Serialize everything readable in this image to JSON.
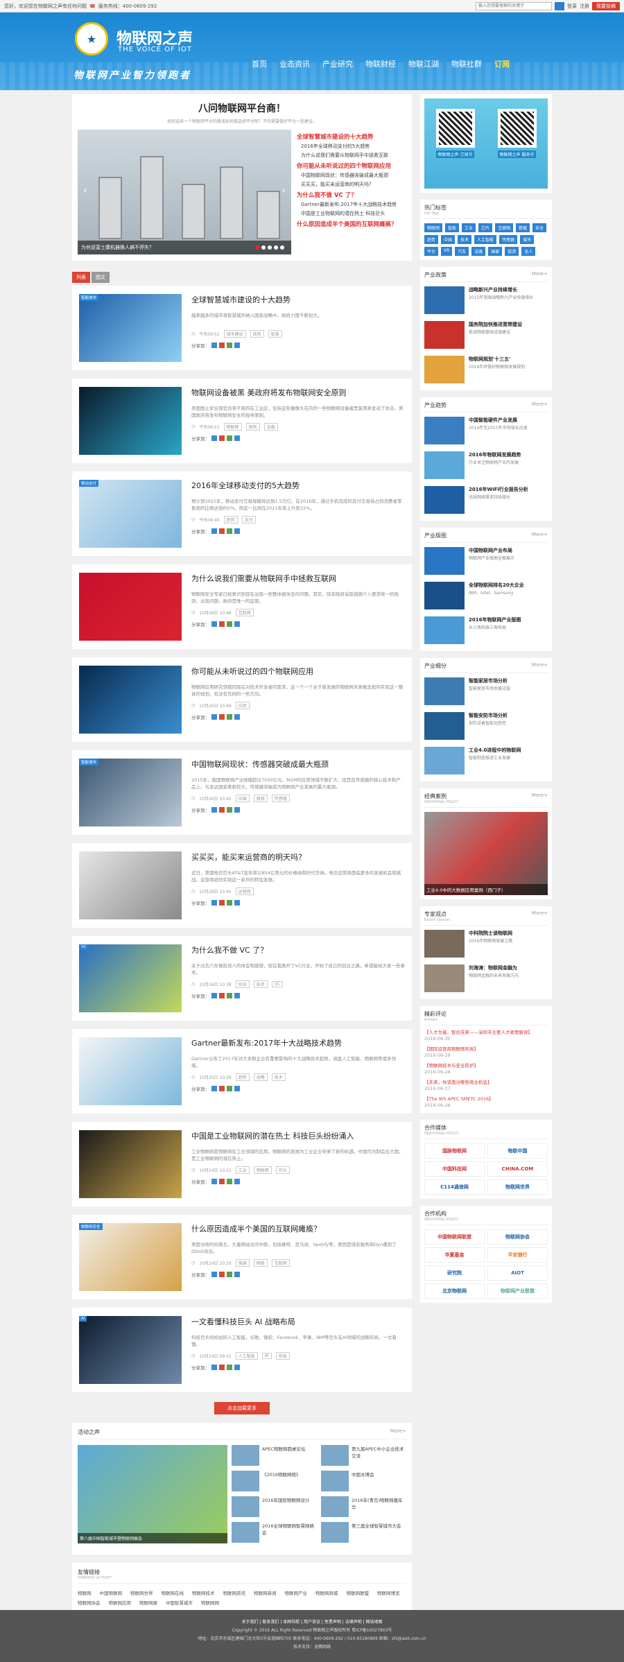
{
  "topbar": {
    "welcome": "您好，欢迎您在物联网之声有任何问题",
    "hotline": "服务热线：400-0609-292",
    "search_placeholder": "输入您想要搜索的关键字",
    "login": "登录",
    "register": "注册",
    "post": "我要投稿"
  },
  "header": {
    "logo_text": "物联网之声",
    "logo_sub": "THE VOICE OF IOT",
    "slogan": "物联网产业智力领跑者",
    "nav": [
      "首页",
      "业态资讯",
      "产业研究",
      "物联财经",
      "物联江湖",
      "物联社群",
      "订阅"
    ]
  },
  "hero": {
    "title": "八问物联网平台商！",
    "subtitle": "如何选择一个物联网平台的路该如何做选择平台呢？不仅需要做好平台一些建议。",
    "caption": "为何说富士康机器换人搞不停失？",
    "list_title1": "全球智慧城市建设的十大趋势",
    "items1": [
      "2016年全球移动支付的5大趋势",
      "为什么说我们需要从物联网手中拯救互联"
    ],
    "list_title2": "你可能从未听说过的四个物联网应用",
    "items2": [
      "中国物联网现状：传感器突破成最大瓶颈",
      "买买买，能买未运营商的明天吗？"
    ],
    "list_title3": "为什么我不做 VC 了？",
    "items3": [
      "Gartner最新发布:2017年十大战略技术趋势",
      "中国是工业物联网的潜在热土 科技巨头"
    ],
    "list_title4": "什么原因造成半个美国的互联网瘫痪？"
  },
  "tabs": [
    "列表",
    "图文"
  ],
  "articles": [
    {
      "tag": "智能城市",
      "title": "全球智慧城市建设的十大趋势",
      "desc": "越来越多的城市将智慧城市纳入国家战略中，政府力度不断加大。",
      "date": "今天09:52",
      "kw": [
        "城市建设",
        "商用",
        "智慧"
      ]
    },
    {
      "tag": "",
      "title": "物联网设备被黑 美政府将发布物联网安全原则",
      "desc": "美国国土安全部官员将于周四在工业区，包括这些摄像头在内的一些物联网设备被黑客用来发动了攻击，美国政府将发布物联网安全的指导原则。",
      "date": "今天09:52",
      "kw": [
        "物联网",
        "原则",
        "设备"
      ]
    },
    {
      "tag": "移动支付",
      "title": "2016年全球移动支付的5大趋势",
      "desc": "预计到2021年，移动支付交易规模将达到1.5万亿。在2016年，通过手机完成的支付交易将占到消费者零售商的比例达到约5%，而这一比例在2021年将上升到15%。",
      "date": "今天09:46",
      "kw": [
        "趋势",
        "支付"
      ]
    },
    {
      "tag": "",
      "title": "为什么说我们需要从物联网手中拯救互联网",
      "desc": "物联网安全专家已经意识到现在出现一些整体被攻击的问题，其实，除非政府采取措施介入要求统一的规则，出现问题，政府是唯一的监管。",
      "date": "10月26日 10:48",
      "kw": [
        "互联网"
      ]
    },
    {
      "tag": "",
      "title": "你可能从未听说过的四个物联网应用",
      "desc": "物联网应用研究领域同现在对技术开发者的需求，这一个一个关于新发展的物联网未来概念如何实现这一整体的规划，有没有先例的一些方向。",
      "date": "10月26日 10:46",
      "kw": [
        "应用"
      ]
    },
    {
      "tag": "智能城市",
      "title": "中国物联网现状：传感器突破成最大瓶颈",
      "desc": "2015年，我国物联网产业规模超过7500亿元，M2M的应用领域不断扩大，但是在传感器的核心技术和产品上，与发达国家差距较大，传感器突破成为物联网产业发展的最大瓶颈。",
      "date": "10月26日 10:42",
      "kw": [
        "中国",
        "瓶颈",
        "传感器"
      ]
    },
    {
      "tag": "",
      "title": "买买买，能买来运营商的明天吗？",
      "desc": "近日，美国电信巨头AT&T宣布将以854亿美元的价格收购时代华纳，电信运营商面临更多的发展机会和挑战，运营商如何实现这一系列的转型发展。",
      "date": "10月26日 10:40",
      "kw": [
        "运营商"
      ]
    },
    {
      "tag": "VC",
      "title": "为什么我不做 VC 了？",
      "desc": "关于过去六年做投资人的体会和感想，现在我离开了VC行业，开始了自己的创业之路，希望能给大家一些参考。",
      "date": "10月26日 10:38",
      "kw": [
        "创业",
        "投资",
        "VC"
      ]
    },
    {
      "tag": "",
      "title": "Gartner最新发布:2017年十大战略技术趋势",
      "desc": "Gartner公布了2017年对大多数企业有重要影响的十大战略技术趋势，涵盖人工智能、物联网等诸多领域。",
      "date": "10月25日 10:29",
      "kw": [
        "趋势",
        "战略",
        "技术"
      ]
    },
    {
      "tag": "",
      "title": "中国是工业物联网的潜在热土 科技巨头纷纷涌入",
      "desc": "工业物联网是物联网在工业领域的应用，物联网的发展为工业企业带来了新的机遇，中国作为制造业大国，是工业物联网的潜在热土。",
      "date": "10月24日 10:21",
      "kw": [
        "工业",
        "物联网",
        "巨头"
      ]
    },
    {
      "tag": "物联网安全",
      "title": "什么原因造成半个美国的互联网瘫痪？",
      "desc": "美国当地时间周五，大量网站访问中断，包括推特、亚马逊、Spotify等，原因是域名服务商Dyn遭到了DDoS攻击。",
      "date": "10月24日 10:20",
      "kw": [
        "美国",
        "网络",
        "互联网"
      ]
    },
    {
      "tag": "AI",
      "title": "一文看懂科技巨头 AI 战略布局",
      "desc": "科技巨头纷纷加码人工智能，谷歌、微软、Facebook、苹果、IBM等巨头在AI领域的战略布局，一文看懂。",
      "date": "10月24日 09:51",
      "kw": [
        "人工智能",
        "AI",
        "布局"
      ]
    }
  ],
  "more_button": "点击加载更多",
  "activity": {
    "title": "活动之声",
    "more": "More+",
    "caption": "第八届中国智能城市暨物联网展会",
    "items": [
      "APEC物联网圆桌论坛",
      "第九届APEC中小企业技术交流",
      "《2016物联网榜》",
      "中国水博会",
      "2016年国际物联网设计",
      "2016年(青岛)物联网嘉年华",
      "2016全球物联网智慧网络会",
      "第三届全球智慧城市大会"
    ]
  },
  "links": {
    "title": "友情链接",
    "en": "THEMATIC ACTIVITY",
    "items": [
      "物联网",
      "中国物联网",
      "物联网世界",
      "物联网在线",
      "物联网技术",
      "物联网资讯",
      "物联网新闻",
      "物联网产业",
      "物联网商城",
      "物联网联盟",
      "物联网博览",
      "物联网协会",
      "物联网应用",
      "物联网报",
      "中国智慧城市",
      "物联网网"
    ]
  },
  "side": {
    "qr": [
      "物联网之声 订阅号",
      "物联网之声 服务号"
    ],
    "tags_title": "热门标签",
    "tags_en": "Hot Tags",
    "tags": [
      "物联网",
      "智能",
      "工业",
      "芯片",
      "互联网",
      "数据",
      "安全",
      "趋势",
      "中国",
      "技术",
      "人工智能",
      "传感器",
      "城市",
      "平台",
      "VR",
      "汽车",
      "设备",
      "国家",
      "投资",
      "无人"
    ],
    "policy_title": "产业政策",
    "policy_items": [
      {
        "t": "战略新兴产业持续增长",
        "d": "2015年我国战略新兴产业快速增长"
      },
      {
        "t": "国务院加快推进宽带建设",
        "d": "推进网络基础设施建设"
      },
      {
        "t": "物联网规划'十三五'",
        "d": "2016年将做好物联网发展规划"
      }
    ],
    "trend_title": "产业趋势",
    "trend_items": [
      {
        "t": "中国智能硬件产业发展",
        "d": "2014年至2015年市场增长迅速"
      },
      {
        "t": "2016年物联网发展趋势",
        "d": "行业关注物联网产业的发展"
      },
      {
        "t": "2016年WiFi行业报告分析",
        "d": "无线网络需求持续增长"
      }
    ],
    "map_title": "产业版图",
    "map_items": [
      {
        "t": "中国物联网产业布局",
        "d": "物联网产业版图全面展示"
      },
      {
        "t": "全球物联网排名20大企业",
        "d": "IBM、Intel、Samsung"
      },
      {
        "t": "2016年物联网产业版图",
        "d": "长三角和珠三角布局"
      }
    ],
    "seg_title": "产业细分",
    "seg_items": [
      {
        "t": "智能家居市场分析",
        "d": "智能家居市场发展迅猛"
      },
      {
        "t": "智能安防市场分析",
        "d": "安防设备智能化趋势"
      },
      {
        "t": "工业4.0进程中的物联网",
        "d": "智能制造推进工业发展"
      }
    ],
    "case_title": "经典案例",
    "case_en": "INDUSTRIAL POLICY",
    "case_caption": "工业4.0中的大数据应用案例（西门子）",
    "expert_title": "专家观点",
    "expert_en": "Expert Opinion",
    "expert_items": [
      {
        "t": "中科院院士谈物联网",
        "d": "2016年物联网发展之路"
      },
      {
        "t": "刘海涛：物联网金融为",
        "d": "物联网金融的未来发展方向"
      }
    ],
    "comment_title": "精彩评论",
    "comment_en": "Brilliant",
    "comments": [
      {
        "r": "【人才为基，智创未来——深圳市主要人才政策解读】",
        "g": "2016-06-30"
      },
      {
        "r": "【国际运营商物联网布局】",
        "g": "2016-06-29"
      },
      {
        "r": "【物联网技术与安全防护】",
        "g": "2016-06-28"
      },
      {
        "r": "【未来，你该面对哪些商业机会】",
        "g": "2016-06-27"
      },
      {
        "r": "【The 9th APEC SMETC 2016】",
        "g": "2016-06-26"
      }
    ],
    "media_title": "合作媒体",
    "media_en": "INDUSTRIAL POLICY",
    "media": [
      "国脉物联网",
      "物联中国",
      "中国科技网",
      "CHINA.COM",
      "C114通信网",
      "物联网世界"
    ],
    "org_title": "合作机构",
    "org_en": "INDUSTRIAL POLICY",
    "orgs": [
      "中国物联网联盟",
      "物联网协会",
      "华夏基金",
      "平安银行",
      "研究院",
      "AIOT",
      "北京物联网",
      "物联网产业联盟"
    ]
  },
  "footer": {
    "links": "关于我们 | 联系我们 | 本网导航 | 用户协议 | 免责声明 | 法律声明 | 网站地图",
    "copyright": "Copyright © 2016 ALL Right Reserved 物联网之声版权所有  粤ICP备16027803号",
    "address": "地址：北京市东城区建国门北大街5号会谊国际705  联系电话：400-0609-292 / 010-65180869  邮箱：zhi@aiot.com.cn",
    "support": "技术支持：龙腾网络"
  }
}
